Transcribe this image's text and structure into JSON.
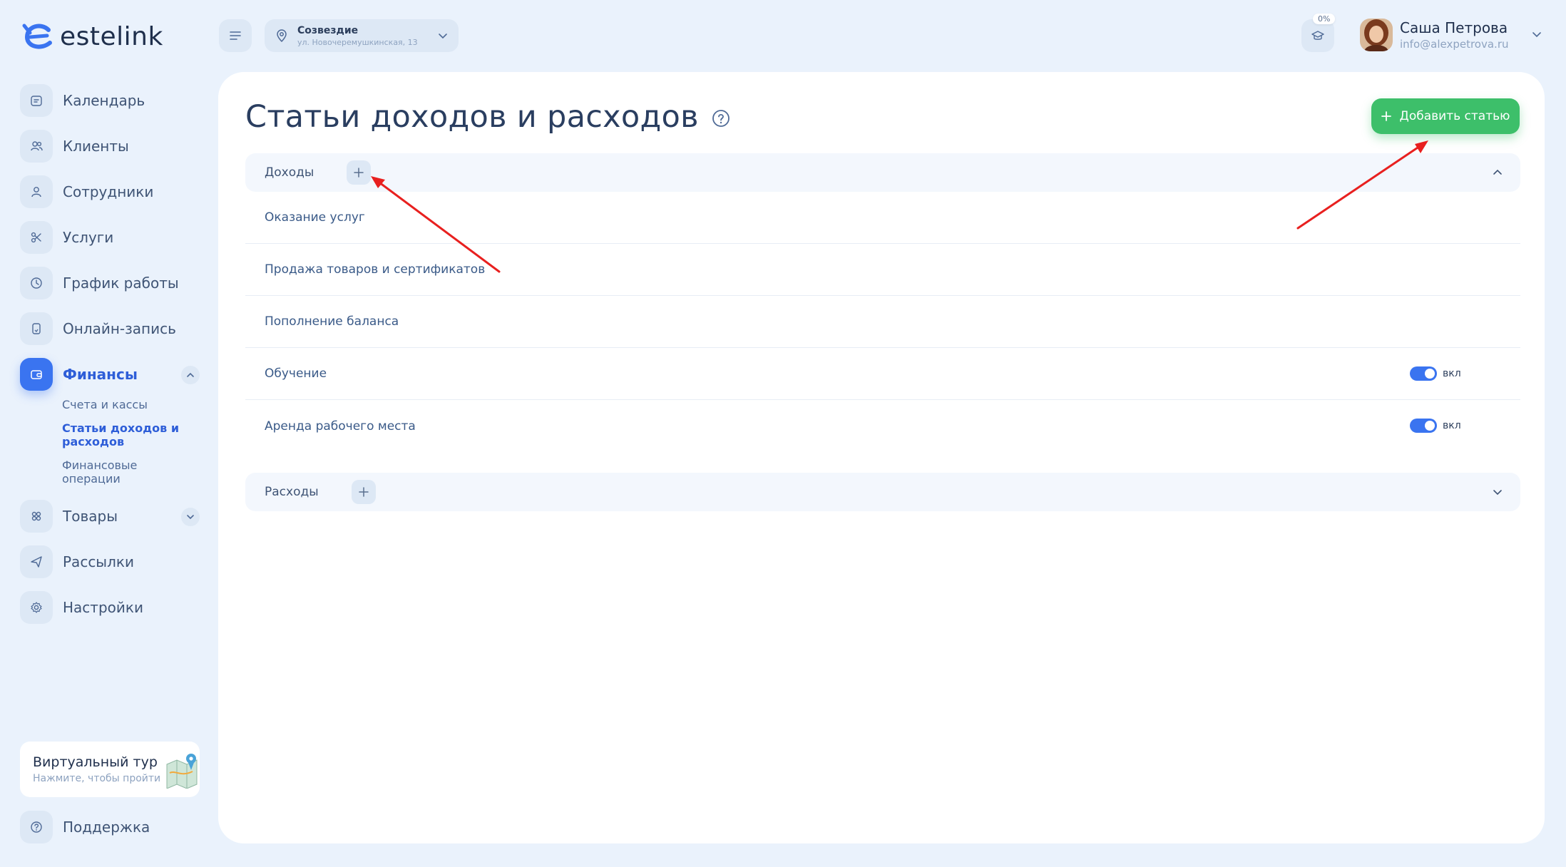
{
  "brand": {
    "name": "estelink"
  },
  "header": {
    "branch_name": "Созвездие",
    "branch_address": "ул. Новочеремушкинская, 13",
    "progress": "0%",
    "user_name": "Саша Петрова",
    "user_email": "info@alexpetrova.ru"
  },
  "sidebar": {
    "items": [
      {
        "label": "Календарь",
        "icon": "calendar-icon"
      },
      {
        "label": "Клиенты",
        "icon": "clients-icon"
      },
      {
        "label": "Сотрудники",
        "icon": "employee-icon"
      },
      {
        "label": "Услуги",
        "icon": "scissors-icon"
      },
      {
        "label": "График работы",
        "icon": "clock-icon"
      },
      {
        "label": "Онлайн-запись",
        "icon": "phone-icon"
      },
      {
        "label": "Финансы",
        "icon": "wallet-icon"
      },
      {
        "label": "Товары",
        "icon": "goods-icon"
      },
      {
        "label": "Рассылки",
        "icon": "send-icon"
      },
      {
        "label": "Настройки",
        "icon": "gear-icon"
      }
    ],
    "finance_sub": [
      "Счета и кассы",
      "Статьи доходов и расходов",
      "Финансовые операции"
    ],
    "tour_title": "Виртуальный тур",
    "tour_sub": "Нажмите, чтобы пройти",
    "support": "Поддержка"
  },
  "main": {
    "title": "Статьи доходов и расходов",
    "add_button": "Добавить статью",
    "income": {
      "title": "Доходы",
      "rows": [
        {
          "label": "Оказание услуг"
        },
        {
          "label": "Продажа товаров и сертификатов"
        },
        {
          "label": "Пополнение баланса"
        },
        {
          "label": "Обучение",
          "toggle": "вкл"
        },
        {
          "label": "Аренда рабочего места",
          "toggle": "вкл"
        }
      ]
    },
    "expense": {
      "title": "Расходы"
    }
  },
  "colors": {
    "accent": "#3a74f0",
    "success": "#3dbf6a",
    "annotation": "#e8201f"
  }
}
